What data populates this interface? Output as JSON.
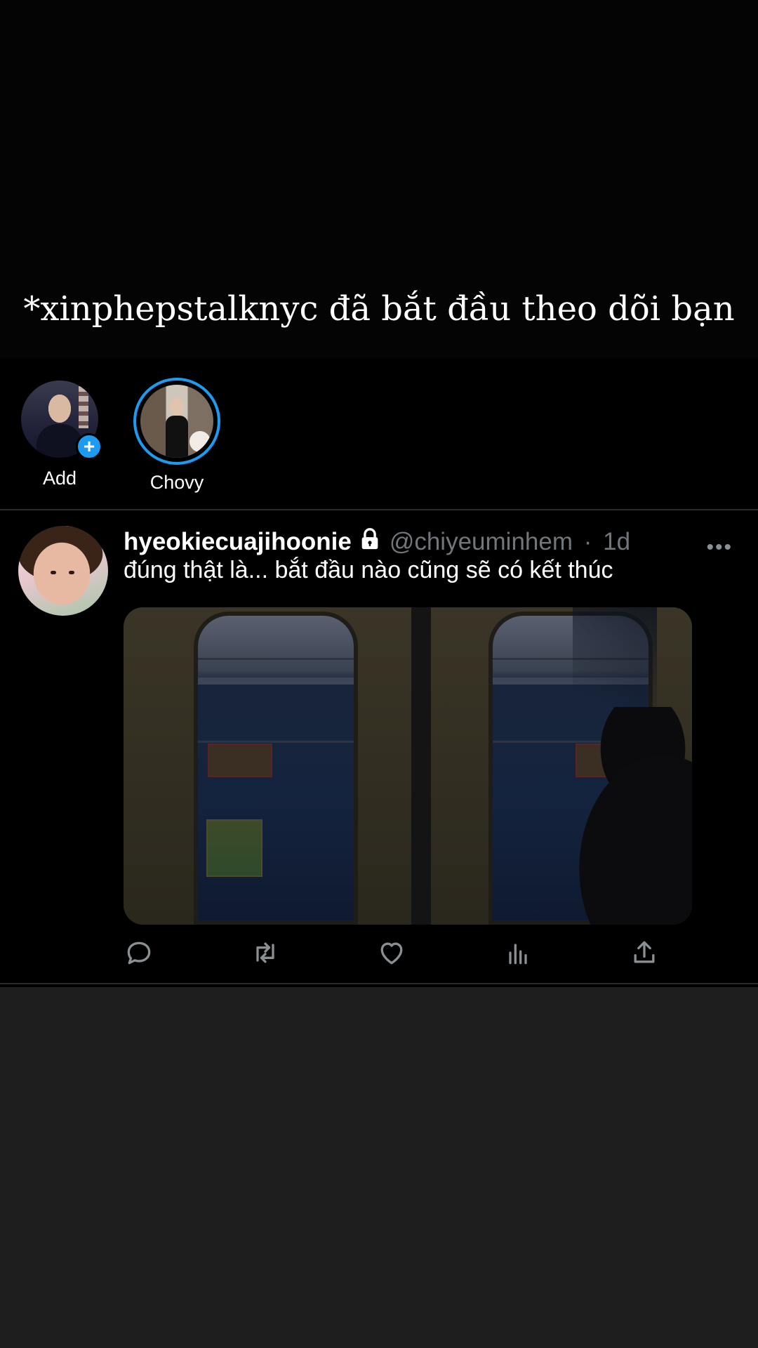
{
  "caption": "*xinphepstalknyc đã bắt đầu theo dõi bạn",
  "stories": [
    {
      "label": "Add",
      "badge": "+"
    },
    {
      "label": "Chovy"
    }
  ],
  "tweet": {
    "display_name": "hyeokiecuajihoonie",
    "handle": "@chiyeuminhem",
    "separator": "·",
    "time": "1d",
    "text": "đúng thật là... bắt đầu nào cũng sẽ có kết thúc",
    "more": "•••"
  },
  "colors": {
    "accent": "#1d9bf0",
    "muted": "#71767b",
    "background": "#000000",
    "lower_background": "#1e1e1e"
  },
  "icons": [
    "lock-icon",
    "more-icon",
    "reply-icon",
    "retweet-icon",
    "like-icon",
    "analytics-icon",
    "share-icon"
  ]
}
